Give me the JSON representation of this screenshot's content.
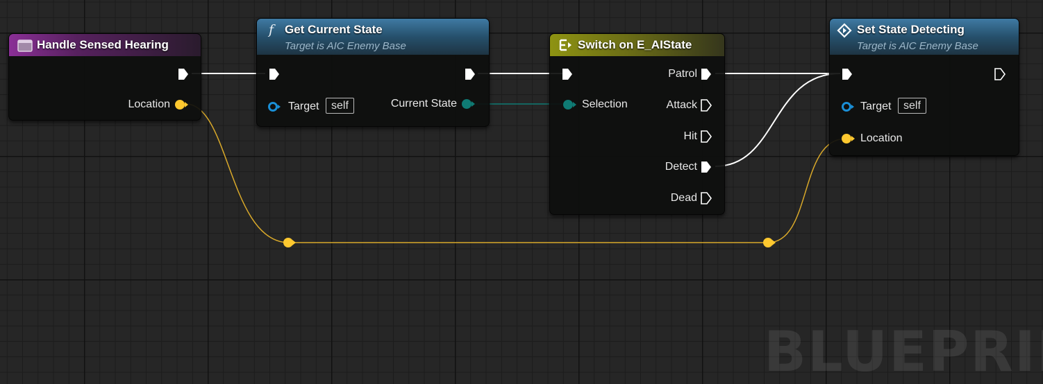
{
  "watermark": "BLUEPRINT",
  "nodes": {
    "event": {
      "title": "Handle Sensed Hearing",
      "location_label": "Location"
    },
    "get_state": {
      "title": "Get Current State",
      "subtitle": "Target is AIC Enemy Base",
      "target_label": "Target",
      "target_value": "self",
      "output_label": "Current State"
    },
    "switch": {
      "title": "Switch on E_AIState",
      "selection_label": "Selection",
      "cases": [
        "Patrol",
        "Attack",
        "Hit",
        "Detect",
        "Dead"
      ]
    },
    "set_state": {
      "title": "Set State Detecting",
      "subtitle": "Target is AIC Enemy Base",
      "target_label": "Target",
      "target_value": "self",
      "location_label": "Location"
    }
  },
  "colors": {
    "exec": "#ffffff",
    "vector_pin": "#fdc82f",
    "vector_wire": "#d9a92a",
    "enum_pin": "#0f7b74",
    "object_pin": "#1a8fd6",
    "event_header": "#8a2f96",
    "function_header": "#3f7aa3",
    "switch_header": "#8e9312"
  },
  "icons": {
    "event": "event-icon",
    "function": "function-icon",
    "switch": "switch-icon",
    "set": "diamond-icon"
  }
}
